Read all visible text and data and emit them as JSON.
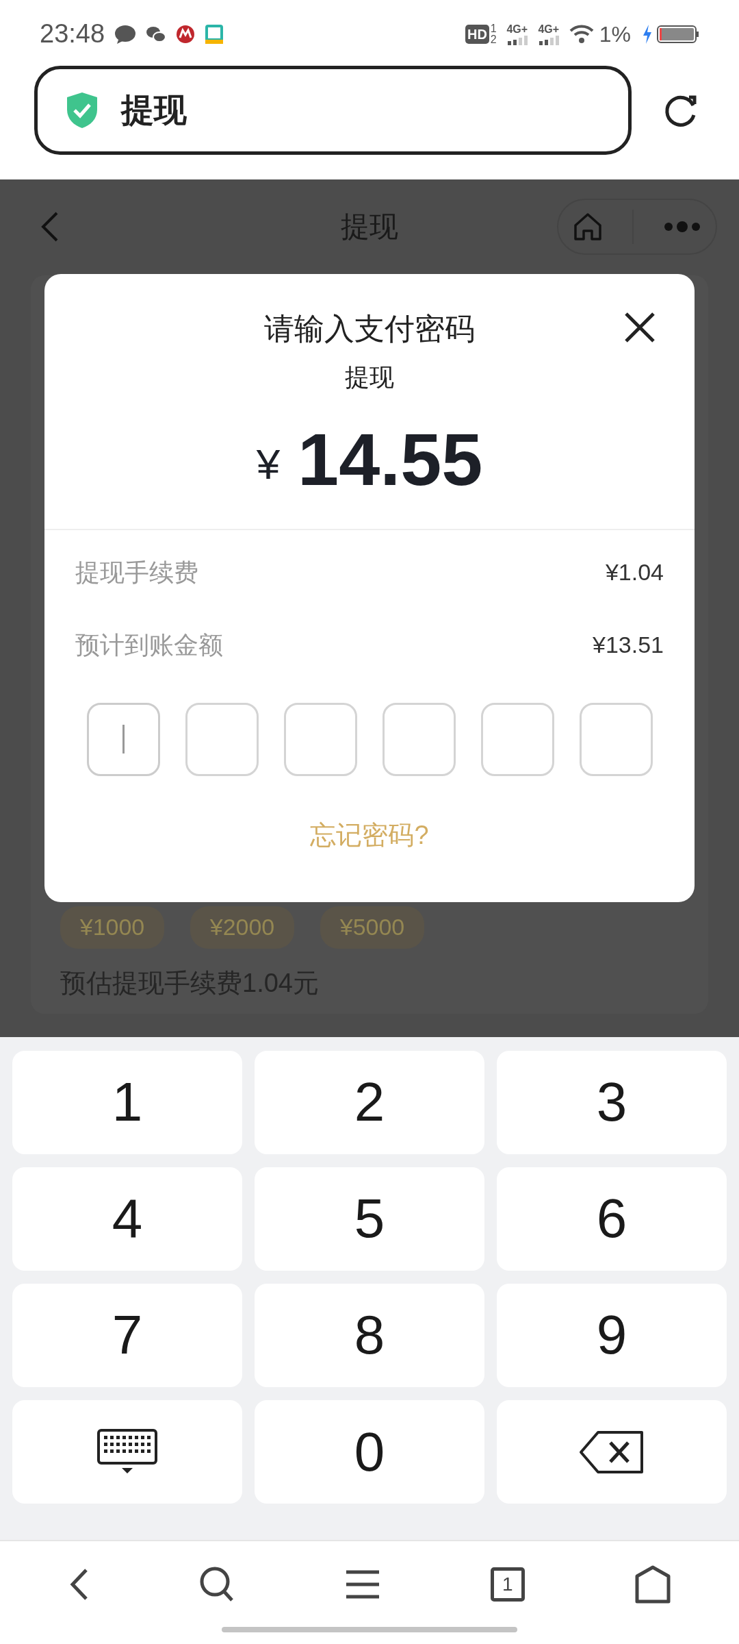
{
  "status_bar": {
    "time": "23:48",
    "hd": "HD",
    "sim_1": "1",
    "sim_2": "2",
    "networks": [
      "4G+",
      "4G+"
    ],
    "battery": "1%"
  },
  "address_bar": {
    "title": "提现"
  },
  "header": {
    "title": "提现"
  },
  "page": {
    "amount_chips": [
      "¥1000",
      "¥2000",
      "¥5000"
    ],
    "fee_note": "预估提现手续费1.04元"
  },
  "dialog": {
    "title": "请输入支付密码",
    "subtitle": "提现",
    "currency": "¥",
    "amount": "14.55",
    "rows": [
      {
        "label": "提现手续费",
        "value": "¥1.04"
      },
      {
        "label": "预计到账金额",
        "value": "¥13.51"
      }
    ],
    "pin_boxes": [
      {
        "focused": true
      },
      {
        "focused": false
      },
      {
        "focused": false
      },
      {
        "focused": false
      },
      {
        "focused": false
      },
      {
        "focused": false
      }
    ],
    "forgot_link": "忘记密码?"
  },
  "keypad": [
    {
      "kind": "digit",
      "label": "1"
    },
    {
      "kind": "digit",
      "label": "2"
    },
    {
      "kind": "digit",
      "label": "3"
    },
    {
      "kind": "digit",
      "label": "4"
    },
    {
      "kind": "digit",
      "label": "5"
    },
    {
      "kind": "digit",
      "label": "6"
    },
    {
      "kind": "digit",
      "label": "7"
    },
    {
      "kind": "digit",
      "label": "8"
    },
    {
      "kind": "digit",
      "label": "9"
    },
    {
      "kind": "hide"
    },
    {
      "kind": "digit",
      "label": "0"
    },
    {
      "kind": "delete"
    }
  ],
  "bottom_nav": {
    "tab_count": "1"
  }
}
